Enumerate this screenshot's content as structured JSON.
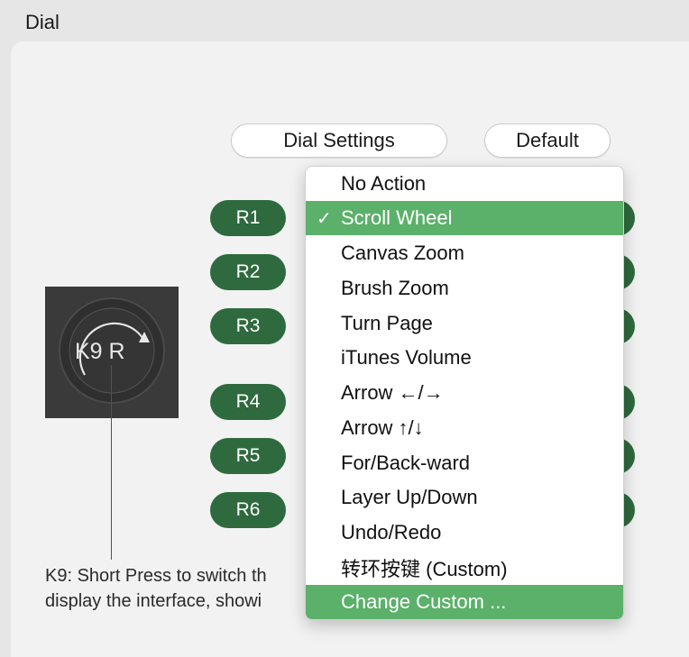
{
  "window": {
    "title": "Dial"
  },
  "header_buttons": {
    "dial_settings": "Dial Settings",
    "default": "Default"
  },
  "rings": [
    {
      "label": "R1"
    },
    {
      "label": "R2"
    },
    {
      "label": "R3"
    },
    {
      "label": "R4"
    },
    {
      "label": "R5"
    },
    {
      "label": "R6"
    }
  ],
  "device": {
    "dial_text": "K9 R"
  },
  "description": {
    "line1": "K9: Short Press to switch th",
    "line2": "display the interface, showi"
  },
  "menu": {
    "checkmark": "✓",
    "items": [
      {
        "label": "No Action"
      },
      {
        "label": "Scroll Wheel",
        "selected": true
      },
      {
        "label": "Canvas Zoom"
      },
      {
        "label": "Brush Zoom"
      },
      {
        "label": "Turn Page"
      },
      {
        "label": "iTunes Volume"
      },
      {
        "label": "Arrow ←/→"
      },
      {
        "label": "Arrow ↑/↓"
      },
      {
        "label": "For/Back-ward"
      },
      {
        "label": "Layer Up/Down"
      },
      {
        "label": "Undo/Redo"
      },
      {
        "label": "转环按键 (Custom)"
      },
      {
        "label": "Change Custom ...",
        "highlighted": true
      }
    ]
  },
  "colors": {
    "accent_green": "#2e6a3d",
    "menu_highlight": "#5bb06a",
    "device_bg": "#3a3a3a"
  }
}
